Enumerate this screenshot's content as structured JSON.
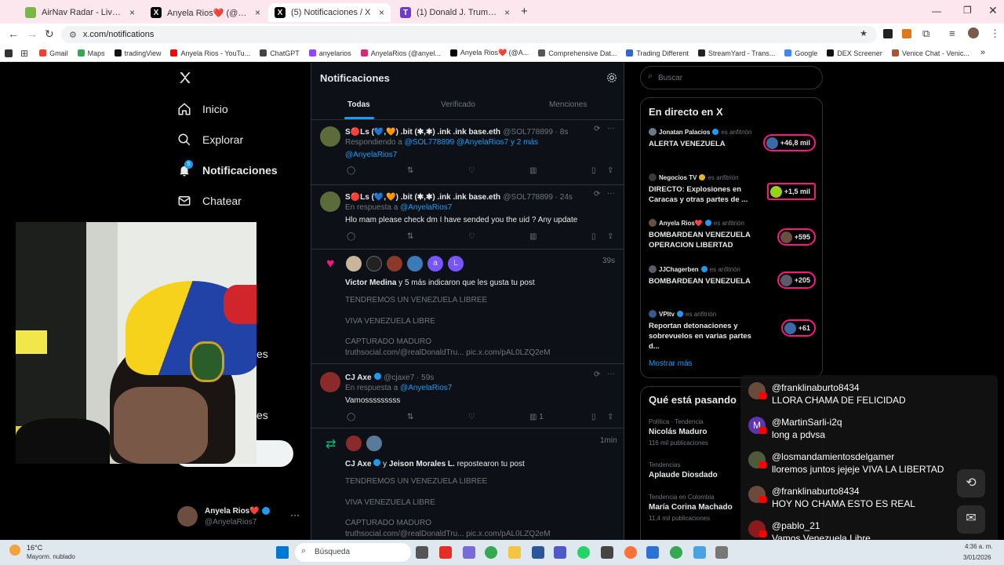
{
  "browser": {
    "tabs": [
      {
        "title": "AirNav Radar - Live Flight Track",
        "color": "#7ab648",
        "glyph": ""
      },
      {
        "title": "Anyela Rios❤️ (@AnyelaRios7) / X",
        "color": "#000000",
        "glyph": "X"
      },
      {
        "title": "(5) Notificaciones / X",
        "color": "#000000",
        "glyph": "X"
      },
      {
        "title": "(1) Donald J. Trump (@realDonaldTrump)",
        "color": "#6f3cc8",
        "glyph": "T"
      }
    ],
    "new_tab": "+",
    "url": "x.com/notifications",
    "bookmarks": [
      {
        "label": "Gmail",
        "color": "#ea4335"
      },
      {
        "label": "Maps",
        "color": "#34a853"
      },
      {
        "label": "tradingView",
        "color": "#111111"
      },
      {
        "label": "Anyela Rios - YouTu...",
        "color": "#ff0000"
      },
      {
        "label": "ChatGPT",
        "color": "#444444"
      },
      {
        "label": "anyelarios",
        "color": "#9146ff"
      },
      {
        "label": "AnyelaRios (@anyel...",
        "color": "#d62976"
      },
      {
        "label": "Anyela Rios❤️ (@A...",
        "color": "#000000"
      },
      {
        "label": "Comprehensive Dat...",
        "color": "#555555"
      },
      {
        "label": "Trading Different",
        "color": "#3366cc"
      },
      {
        "label": "StreamYard - Trans...",
        "color": "#222222"
      },
      {
        "label": "Google",
        "color": "#4285f4"
      },
      {
        "label": "DEX Screener",
        "color": "#111111"
      },
      {
        "label": "Venice Chat - Venic...",
        "color": "#aa5533"
      }
    ],
    "more": "»"
  },
  "nav": {
    "items": [
      {
        "label": "Inicio",
        "icon": "home-icon"
      },
      {
        "label": "Explorar",
        "icon": "search-icon"
      },
      {
        "label": "Notificaciones",
        "icon": "bell-icon"
      },
      {
        "label": "Chatear",
        "icon": "mail-icon"
      }
    ],
    "badge": "5",
    "partial_1": "es",
    "partial_2": "es",
    "account_name": "Anyela Rios❤️",
    "account_handle": "@AnyelaRios7",
    "more": "···"
  },
  "notifications": {
    "title": "Notificaciones",
    "tabs": [
      "Todas",
      "Verificado",
      "Menciones"
    ],
    "posts": [
      {
        "name": "S🔴Ls (💙,🧡) .bit (✱,✱) .ink .ink base.eth",
        "handle": "@SOL778899 · 8s",
        "context_prefix": "Respondiendo a ",
        "context_link": "@SOL778899 @AnyelaRios7 y 2 más",
        "context_link2": "@AnyelaRios7",
        "text": ""
      },
      {
        "name": "S🔴Ls (💙,🧡) .bit (✱,✱) .ink .ink base.eth",
        "handle": "@SOL778899 · 24s",
        "context_prefix": "En respuesta a ",
        "context_link": "@AnyelaRios7",
        "text": "Hlo mam please check dm I have sended you the uid ? Any update"
      },
      {
        "time": "39s",
        "summary_bold": "Victor Medina",
        "summary_rest": " y 5 más indicaron que les gusta tu post",
        "lines": [
          "TENDREMOS UN VENEZUELA LIBREE",
          "VIVA VENEZUELA LIBRE",
          "CAPTURADO MADURO",
          "truthsocial.com/@realDonaldTru... pic.x.com/pAL0LZQ2eM"
        ]
      },
      {
        "name": "CJ Axe",
        "handle": "@cjaxe7 · 59s",
        "context_prefix": "En respuesta a ",
        "context_link": "@AnyelaRios7",
        "text": "Vamosssssssss",
        "views": "1"
      },
      {
        "time": "1min",
        "summary_bold": "CJ Axe",
        "summary_mid": " y ",
        "summary_bold2": "Jeison Morales L.",
        "summary_rest": " repostearon tu post",
        "lines": [
          "TENDREMOS UN VENEZUELA LIBREE",
          "VIVA VENEZUELA LIBRE",
          "CAPTURADO MADURO",
          "truthsocial.com/@realDonaldTru... pic.x.com/pAL0LZQ2eM"
        ]
      }
    ],
    "avatar_letters": [
      "a",
      "L"
    ]
  },
  "sidebar": {
    "search_placeholder": "Buscar",
    "live_title": "En directo en X",
    "spaces": [
      {
        "host": "Jonatan Palacios",
        "role": "es anfitrión",
        "title": "ALERTA VENEZUELA",
        "count": "+46,8 mil"
      },
      {
        "host": "Negocios TV",
        "role": "es anfitrión",
        "title": "DIRECTO: Explosiones en Caracas y otras partes de ...",
        "count": "+1,5 mil"
      },
      {
        "host": "Anyela Rios❤️",
        "role": "es anfitrión",
        "title": "BOMBARDEAN VENEZUELA OPERACION LIBERTAD",
        "count": "+595"
      },
      {
        "host": "JJChagerben",
        "role": "es anfitrión",
        "title": "BOMBARDEAN VENEZUELA",
        "count": "+205"
      },
      {
        "host": "VPItv",
        "role": "es anfitrión",
        "title": "Reportan detonaciones y sobrevuelos en varias partes d...",
        "count": "+61"
      }
    ],
    "show_more": "Mostrar más",
    "trends_title": "Qué está pasando",
    "trends": [
      {
        "context": "Política · Tendencia",
        "name": "Nicolás Maduro",
        "count": "116 mil publicaciones"
      },
      {
        "context": "Tendencias",
        "name": "Aplaude Diosdado",
        "count": ""
      },
      {
        "context": "Tendencia en Colombia",
        "name": "María Corina Machado",
        "count": "11,4 mil publicaciones"
      }
    ]
  },
  "livechat": [
    {
      "user": "@franklinaburto8434",
      "msg": "LLORA CHAMA DE FELICIDAD",
      "color": "#6a4a3a",
      "letter": ""
    },
    {
      "user": "@MartinSarli-i2q",
      "msg": "long a pdvsa",
      "color": "#5e35b1",
      "letter": "M"
    },
    {
      "user": "@losmandamientosdelgamer",
      "msg": "lloremos juntos jejeje VIVA LA LIBERTAD",
      "color": "#4e5a3a",
      "letter": ""
    },
    {
      "user": "@franklinaburto8434",
      "msg": "HOY NO CHAMA ESTO ES REAL",
      "color": "#6a4a3a",
      "letter": ""
    },
    {
      "user": "@pablo_21",
      "msg": "Vamos Venezuela Libre",
      "color": "#8b1a1a",
      "letter": ""
    }
  ],
  "taskbar": {
    "weather_temp": "16°C",
    "weather_desc": "Mayorm. nublado",
    "search_placeholder": "Búsqueda",
    "date": "3/01/2026",
    "time": "4:36 a. m."
  }
}
